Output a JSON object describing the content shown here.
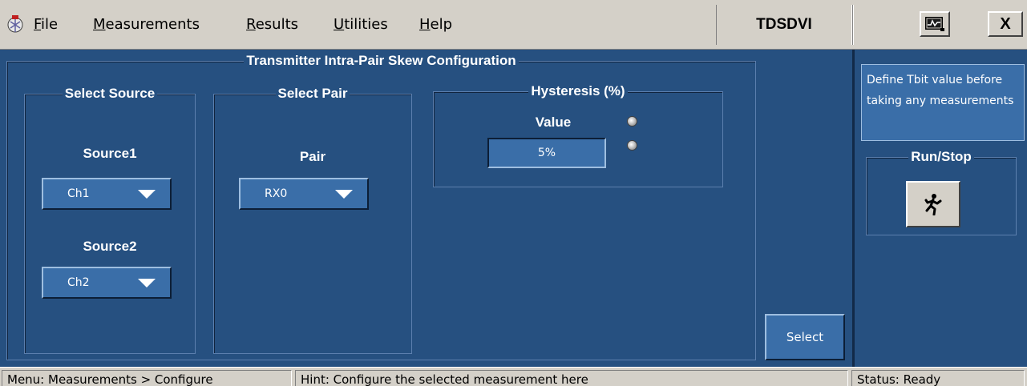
{
  "menubar": {
    "items": [
      {
        "label": "File"
      },
      {
        "label": "Measurements"
      },
      {
        "label": "Results"
      },
      {
        "label": "Utilities"
      },
      {
        "label": "Help"
      }
    ],
    "app_title": "TDSDVI",
    "close_glyph": "X",
    "icons": [
      "app-logo-icon",
      "minimize-scope-icon"
    ]
  },
  "config": {
    "title": "Transmitter Intra-Pair Skew Configuration",
    "source_group": {
      "title": "Select Source",
      "source1_label": "Source1",
      "source1_value": "Ch1",
      "source2_label": "Source2",
      "source2_value": "Ch2"
    },
    "pair_group": {
      "title": "Select Pair",
      "pair_label": "Pair",
      "pair_value": "RX0"
    },
    "hysteresis_group": {
      "title": "Hysteresis (%)",
      "value_label": "Value",
      "value": "5%"
    },
    "select_label": "Select"
  },
  "side": {
    "hint": "Define Tbit value before taking any measurements",
    "run_title": "Run/Stop",
    "run_icon": "running-man-icon"
  },
  "statusbar": {
    "menu": "Menu: Measurements > Configure",
    "hint": "Hint: Configure the selected measurement here",
    "status": "Status: Ready"
  },
  "colors": {
    "panel_bg": "#265080",
    "control_bg": "#3a6ea8",
    "chrome": "#d4d0c8"
  }
}
